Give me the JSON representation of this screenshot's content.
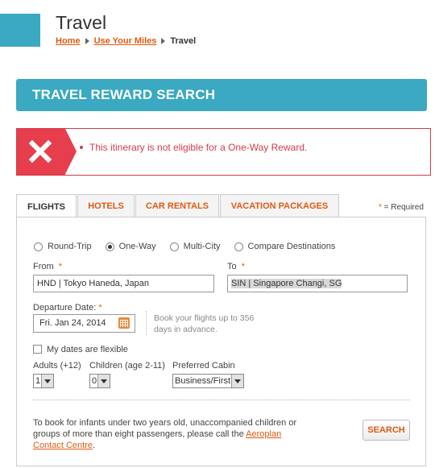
{
  "header": {
    "title": "Travel",
    "breadcrumb": {
      "home": "Home",
      "use_miles": "Use Your Miles",
      "current": "Travel"
    }
  },
  "section_title": "TRAVEL REWARD SEARCH",
  "error": {
    "icon": "close-icon",
    "message": "This itinerary is not eligible for a One-Way Reward.",
    "color": "#e63e4c"
  },
  "tabs": [
    {
      "label": "FLIGHTS",
      "active": true
    },
    {
      "label": "HOTELS",
      "active": false
    },
    {
      "label": "CAR RENTALS",
      "active": false
    },
    {
      "label": "VACATION PACKAGES",
      "active": false
    }
  ],
  "required_note": {
    "star": "*",
    "text": " = Required"
  },
  "trip_types": [
    {
      "label": "Round-Trip",
      "checked": false
    },
    {
      "label": "One-Way",
      "checked": true
    },
    {
      "label": "Multi-City",
      "checked": false
    },
    {
      "label": "Compare Destinations",
      "checked": false
    }
  ],
  "form": {
    "from_label": "From",
    "from_value": "HND | Tokyo Haneda, Japan",
    "to_label": "To",
    "to_value": "SIN | Singapore Changi, SG",
    "required_star": "*",
    "departure_label": "Departure Date:",
    "departure_value": "Fri. Jan 24, 2014",
    "hint": "Book your flights up to 356 days in advance.",
    "flexible_label": "My dates are flexible",
    "flexible_checked": false,
    "adults_label": "Adults (+12)",
    "adults_value": "1",
    "children_label": "Children (age 2-11)",
    "children_value": "0",
    "cabin_label": "Preferred Cabin",
    "cabin_value": "Business/First"
  },
  "info": {
    "text": "To book for infants under two years old, unaccompanied children or groups of more than eight passengers, please call the ",
    "link": "Aeroplan Contact Centre",
    "end": "."
  },
  "search_button": "SEARCH",
  "colors": {
    "accent": "#3aa9c1",
    "link": "#e05a12",
    "error": "#d33a4a"
  }
}
